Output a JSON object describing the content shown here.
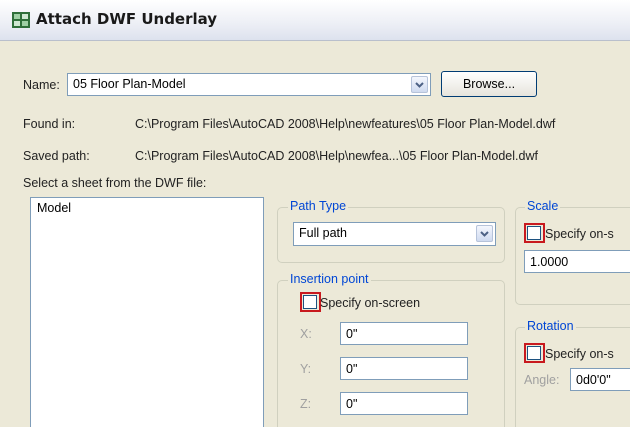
{
  "dialog": {
    "title": "Attach DWF Underlay",
    "name_label": "Name:",
    "name_value": "05 Floor Plan-Model",
    "browse_label": "Browse...",
    "found_in_label": "Found in:",
    "found_in_value": "C:\\Program Files\\AutoCAD 2008\\Help\\newfeatures\\05 Floor Plan-Model.dwf",
    "saved_path_label": "Saved path:",
    "saved_path_value": "C:\\Program Files\\AutoCAD 2008\\Help\\newfea...\\05 Floor Plan-Model.dwf",
    "sheet_prompt": "Select a sheet from the DWF file:",
    "sheets": [
      "Model"
    ]
  },
  "path_type": {
    "legend": "Path Type",
    "selected": "Full path"
  },
  "insertion": {
    "legend": "Insertion point",
    "specify_label": "Specify on-screen",
    "x_label": "X:",
    "x_value": "0\"",
    "y_label": "Y:",
    "y_value": "0\"",
    "z_label": "Z:",
    "z_value": "0\""
  },
  "scale": {
    "legend": "Scale",
    "specify_label": "Specify on-s",
    "value": "1.0000"
  },
  "rotation": {
    "legend": "Rotation",
    "specify_label": "Specify on-s",
    "angle_label": "Angle:",
    "angle_value": "0d0'0\""
  },
  "colors": {
    "highlight": "#c8191e",
    "legend_text": "#0046d5",
    "dialog_bg": "#ece9d8"
  },
  "icons": {
    "title": "dwf-underlay-icon",
    "dropdown": "chevron-down-icon"
  }
}
